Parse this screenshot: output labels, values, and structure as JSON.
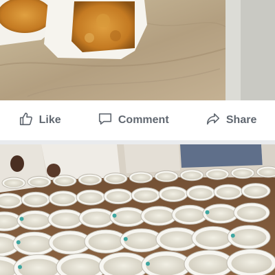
{
  "post": {
    "top_photo": {
      "content": "food-containers-on-marble-counter"
    },
    "actions": [
      {
        "label": "Like",
        "icon": "thumbs-up-icon"
      },
      {
        "label": "Comment",
        "icon": "comment-bubble-icon"
      },
      {
        "label": "Share",
        "icon": "share-arrow-icon"
      }
    ],
    "bottom_photo": {
      "content": "rows-of-bowls-with-rice-pudding"
    }
  },
  "colors": {
    "action_text": "#606770",
    "bar_background": "#ffffff",
    "feed_background": "#e9ebee"
  }
}
